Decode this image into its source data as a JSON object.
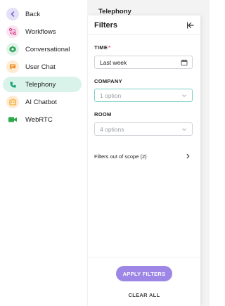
{
  "sidebar": {
    "items": [
      {
        "label": "Back",
        "icon": "chevron-left-icon",
        "icon_bg": "#e4e1f7",
        "icon_color": "#6b5bd6"
      },
      {
        "label": "Workflows",
        "icon": "workflow-icon",
        "icon_bg": "#fbe4f0",
        "icon_color": "#d64b95"
      },
      {
        "label": "Conversational",
        "icon": "conversational-icon",
        "icon_bg": "#dff3e6",
        "icon_color": "#2ea15a"
      },
      {
        "label": "User Chat",
        "icon": "chat-bubble-icon",
        "icon_bg": "#fdebd2",
        "icon_color": "#f08a1c"
      },
      {
        "label": "Telephony",
        "icon": "phone-icon",
        "icon_bg": "#d9f3ea",
        "icon_color": "#1fa37a",
        "active": true
      },
      {
        "label": "AI Chatbot",
        "icon": "robot-icon",
        "icon_bg": "#fdebd2",
        "icon_color": "#f0a21c"
      },
      {
        "label": "WebRTC",
        "icon": "video-camera-icon",
        "icon_bg": "#ffffff",
        "icon_color": "#2aa84a"
      }
    ]
  },
  "page": {
    "title": "Telephony"
  },
  "filters": {
    "header": "Filters",
    "time": {
      "label": "TIME",
      "required_mark": "*",
      "value": "Last week"
    },
    "company": {
      "label": "COMPANY",
      "value": "1 option"
    },
    "room": {
      "label": "ROOM",
      "value": "4 options"
    },
    "scope_text": "Filters out of scope (2)",
    "apply_label": "APPLY FILTERS",
    "clear_label": "CLEAR ALL"
  },
  "colors": {
    "accent": "#9d86e6",
    "active_nav": "#d9f3ea",
    "required": "#e24b6b"
  }
}
